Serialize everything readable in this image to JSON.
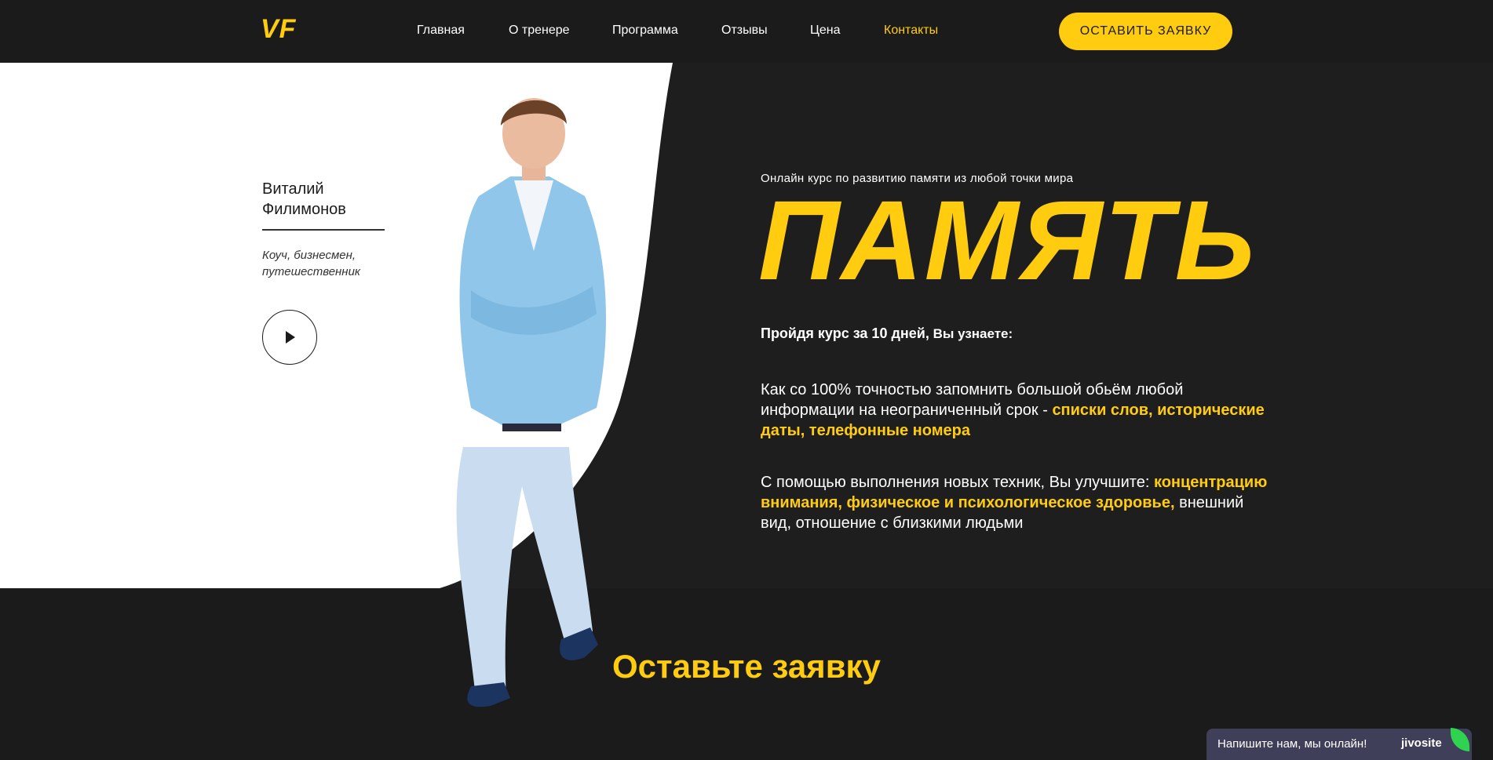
{
  "header": {
    "logo": "VF",
    "nav": [
      {
        "label": "Главная",
        "active": false
      },
      {
        "label": "О тренере",
        "active": false
      },
      {
        "label": "Программа",
        "active": false
      },
      {
        "label": "Отзывы",
        "active": false
      },
      {
        "label": "Цена",
        "active": false
      },
      {
        "label": "Контакты",
        "active": true
      }
    ],
    "cta_label": "ОСТАВИТЬ ЗАЯВКУ"
  },
  "trainer": {
    "first_name": "Виталий",
    "last_name": "Филимонов",
    "desc_line1": "Коуч, бизнесмен,",
    "desc_line2": "путешественник",
    "play_icon": "play-icon"
  },
  "hero": {
    "subtitle": "Онлайн курс по развитию памяти из любой точки мира",
    "headline": "ПАМЯТЬ",
    "intro_bold": "Пройдя курс за 10 дней,",
    "intro_rest": " Вы узнаете:",
    "p1_start": "Как со 100% точностью запомнить большой обьём любой информации на неограниченный срок - ",
    "p1_highlight": "списки слов, исторические даты, телефонные номера",
    "p2_start": "С помощью выполнения новых техник, Вы улучшите: ",
    "p2_highlight": "концентрацию внимания, физическое и психологическое здоровье,",
    "p2_end": " внешний вид, отношение с близкими людьми"
  },
  "section": {
    "title": "Оставьте заявку"
  },
  "chat": {
    "text": "Напишите нам, мы онлайн!",
    "brand": "jivosite"
  },
  "colors": {
    "accent": "#ffcc10",
    "dark": "#1b1b1b",
    "panel": "#1f1e1e",
    "chat": "#3f3f5a"
  }
}
